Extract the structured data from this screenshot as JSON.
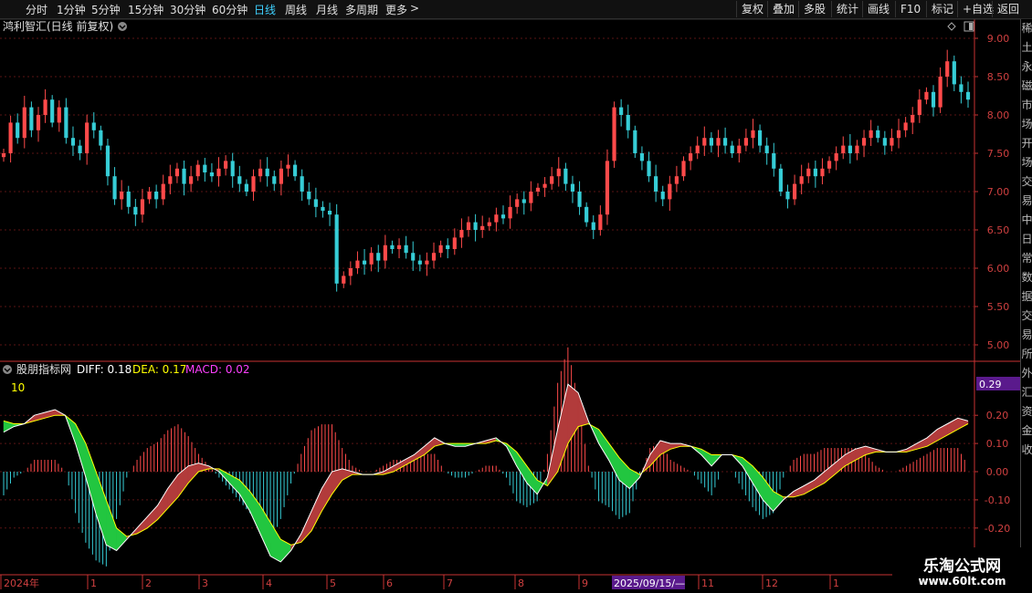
{
  "toolbar": {
    "periods": [
      "分时",
      "1分钟",
      "5分钟",
      "15分钟",
      "30分钟",
      "60分钟",
      "日线",
      "周线",
      "月线",
      "多周期",
      "更多"
    ],
    "active_period": "日线",
    "more_arrow": ">",
    "right_buttons": [
      "复权",
      "叠加",
      "多股",
      "统计",
      "画线",
      "F10",
      "标记",
      "+自选",
      "返回"
    ]
  },
  "colors": {
    "up": "#ff4a4a",
    "down": "#36cdd6",
    "grid": "#5a1414",
    "axis": "#c83232",
    "diff": "#ffffff",
    "dea": "#ffff00",
    "cloud_up": "#b23b3b",
    "cloud_down": "#22c640",
    "purple": "#5a1a8c"
  },
  "price_panel": {
    "title": "鸿利智汇(日线 前复权)",
    "y_ticks": [
      "9.00",
      "8.50",
      "8.00",
      "7.50",
      "7.00",
      "6.50",
      "6.00",
      "5.50",
      "5.00"
    ]
  },
  "macd_panel": {
    "title": "股朋指标网",
    "diff_label": "DIFF: 0.18",
    "dea_label": "DEA: 0.17",
    "macd_label": "MACD: 0.02",
    "marker_10": "10",
    "current_value": "0.29",
    "y_ticks": [
      "0.20",
      "0.10",
      "0.00",
      "-0.10",
      "-0.20"
    ]
  },
  "x_axis": {
    "labels": [
      "2024年",
      "1",
      "2",
      "3",
      "4",
      "5",
      "6",
      "7",
      "8",
      "9",
      "2025/09/15/—",
      "11",
      "12",
      "1"
    ]
  },
  "right_panel_chars": [
    "稀",
    "土",
    "永",
    "磁",
    "市",
    "场",
    "开",
    "场",
    "交",
    "易",
    "中",
    "日",
    "常",
    "数",
    "据",
    "交",
    "易",
    "所",
    "外",
    "汇",
    "资",
    "金",
    "收"
  ],
  "watermark": {
    "line1": "乐淘公式网",
    "line2": "www.60lt.com"
  },
  "chart_data": [
    {
      "type": "candlestick",
      "title": "鸿利智汇(日线 前复权)",
      "ylim": [
        4.85,
        9.1
      ],
      "x_range": "2024-01 to 2026-01",
      "close": [
        7.5,
        7.9,
        7.7,
        8.1,
        7.8,
        8.0,
        8.2,
        7.9,
        8.1,
        7.7,
        7.6,
        7.5,
        7.9,
        7.8,
        7.6,
        7.2,
        6.9,
        7.0,
        6.8,
        6.7,
        6.9,
        7.0,
        6.9,
        7.1,
        7.2,
        7.3,
        7.1,
        7.2,
        7.35,
        7.25,
        7.2,
        7.3,
        7.4,
        7.2,
        7.1,
        7.0,
        7.2,
        7.3,
        7.2,
        7.1,
        7.3,
        7.35,
        7.2,
        7.0,
        6.9,
        6.8,
        6.75,
        6.7,
        5.8,
        5.9,
        6.0,
        6.1,
        6.05,
        6.2,
        6.1,
        6.3,
        6.25,
        6.3,
        6.2,
        6.1,
        6.05,
        6.1,
        6.2,
        6.3,
        6.25,
        6.4,
        6.5,
        6.6,
        6.5,
        6.55,
        6.6,
        6.7,
        6.65,
        6.8,
        6.9,
        6.85,
        7.0,
        7.05,
        7.1,
        7.2,
        7.3,
        7.1,
        7.0,
        6.8,
        6.6,
        6.5,
        6.7,
        7.4,
        8.1,
        8.0,
        7.8,
        7.5,
        7.4,
        7.2,
        7.0,
        6.9,
        7.1,
        7.2,
        7.4,
        7.5,
        7.6,
        7.7,
        7.6,
        7.7,
        7.6,
        7.5,
        7.6,
        7.7,
        7.8,
        7.6,
        7.5,
        7.3,
        7.0,
        6.9,
        7.1,
        7.2,
        7.3,
        7.2,
        7.3,
        7.4,
        7.5,
        7.6,
        7.5,
        7.6,
        7.7,
        7.8,
        7.7,
        7.6,
        7.7,
        7.8,
        7.9,
        8.0,
        8.2,
        8.3,
        8.1,
        8.5,
        8.7,
        8.4,
        8.3,
        8.2
      ]
    },
    {
      "type": "line",
      "title": "股朋指标网",
      "ylim": [
        -0.3,
        0.32
      ],
      "series": [
        {
          "name": "DIFF",
          "values": [
            0.14,
            0.16,
            0.17,
            0.2,
            0.21,
            0.22,
            0.2,
            0.1,
            -0.02,
            -0.15,
            -0.26,
            -0.28,
            -0.24,
            -0.2,
            -0.16,
            -0.12,
            -0.06,
            -0.01,
            0.02,
            0.03,
            0.02,
            0.0,
            -0.04,
            -0.08,
            -0.14,
            -0.22,
            -0.3,
            -0.32,
            -0.28,
            -0.22,
            -0.14,
            -0.06,
            0.0,
            0.01,
            0.0,
            -0.01,
            -0.01,
            0.0,
            0.02,
            0.04,
            0.06,
            0.09,
            0.12,
            0.1,
            0.09,
            0.09,
            0.1,
            0.11,
            0.12,
            0.09,
            0.02,
            -0.04,
            -0.08,
            -0.02,
            0.15,
            0.31,
            0.28,
            0.18,
            0.1,
            0.04,
            -0.03,
            -0.06,
            -0.02,
            0.06,
            0.11,
            0.1,
            0.1,
            0.09,
            0.06,
            0.02,
            0.06,
            0.06,
            0.02,
            -0.04,
            -0.1,
            -0.14,
            -0.1,
            -0.07,
            -0.05,
            -0.03,
            0.0,
            0.03,
            0.06,
            0.08,
            0.09,
            0.08,
            0.07,
            0.07,
            0.08,
            0.1,
            0.12,
            0.15,
            0.17,
            0.19,
            0.18
          ]
        },
        {
          "name": "DEA",
          "values": [
            0.18,
            0.17,
            0.17,
            0.18,
            0.19,
            0.2,
            0.2,
            0.17,
            0.1,
            0.0,
            -0.1,
            -0.2,
            -0.23,
            -0.22,
            -0.2,
            -0.17,
            -0.13,
            -0.09,
            -0.04,
            0.0,
            0.01,
            0.01,
            -0.01,
            -0.03,
            -0.07,
            -0.12,
            -0.18,
            -0.24,
            -0.26,
            -0.25,
            -0.21,
            -0.14,
            -0.08,
            -0.03,
            -0.01,
            -0.01,
            -0.01,
            -0.01,
            0.0,
            0.02,
            0.04,
            0.06,
            0.09,
            0.1,
            0.1,
            0.1,
            0.1,
            0.1,
            0.11,
            0.1,
            0.07,
            0.02,
            -0.03,
            -0.05,
            0.0,
            0.1,
            0.16,
            0.17,
            0.15,
            0.1,
            0.05,
            0.01,
            -0.01,
            0.02,
            0.06,
            0.08,
            0.09,
            0.09,
            0.08,
            0.06,
            0.06,
            0.06,
            0.05,
            0.02,
            -0.02,
            -0.07,
            -0.09,
            -0.09,
            -0.08,
            -0.06,
            -0.04,
            -0.01,
            0.02,
            0.04,
            0.06,
            0.07,
            0.07,
            0.07,
            0.07,
            0.08,
            0.09,
            0.11,
            0.13,
            0.15,
            0.17
          ]
        }
      ]
    }
  ]
}
